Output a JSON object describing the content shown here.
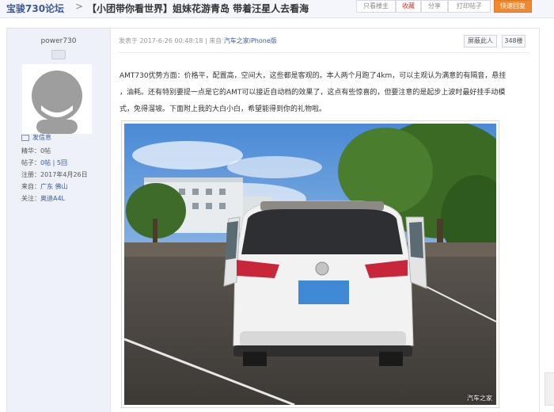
{
  "header": {
    "forum_name": "宝骏730论坛",
    "separator": ">",
    "thread_title": "【小团带你看世界】姐妹花游青岛 带着汪星人去看海",
    "buttons": {
      "only_op": "只看楼主",
      "favorite": "收藏",
      "share": "分享",
      "print": "打印帖子",
      "quick_reply": "快速回复"
    }
  },
  "sidebar": {
    "username": "power730",
    "send_message": "发信息",
    "stats": {
      "essence_label": "精华：",
      "essence_value": "0帖",
      "posts_label": "帖子：",
      "posts_value": "0帖 | 5回",
      "registered_label": "注册：",
      "registered_value": "2017年4月26日",
      "from_label": "来自：",
      "from_value": "广东 佛山",
      "follow_label": "关注：",
      "follow_value": "奥迪A4L"
    }
  },
  "post": {
    "meta_prefix": "发表于 2017-6-26 00:48:18 | 来自",
    "meta_source": "汽车之家iPhone版",
    "block_author_button": "屏蔽此人",
    "floor_label": "348楼",
    "lines": [
      "AMT730优势方面：价格平，配置高，空间大，这些都是客观的。本人两个月跑了4km，可以主观认为满意的有隔音，悬挂",
      "，油耗。还有特别要提一点是它的AMT可以接近自动档的效果了，这点有些惊喜的，但要注意的是起步上波时最好挂手动模",
      "式，免得溜坡。下面附上我的大白小白，希望能得到你的礼物啦。"
    ],
    "photo_watermark": "汽车之家"
  },
  "colors": {
    "link": "#3a5a9b",
    "sidebar_bg": "#eef1f8",
    "reply_button": "#f08a32"
  }
}
